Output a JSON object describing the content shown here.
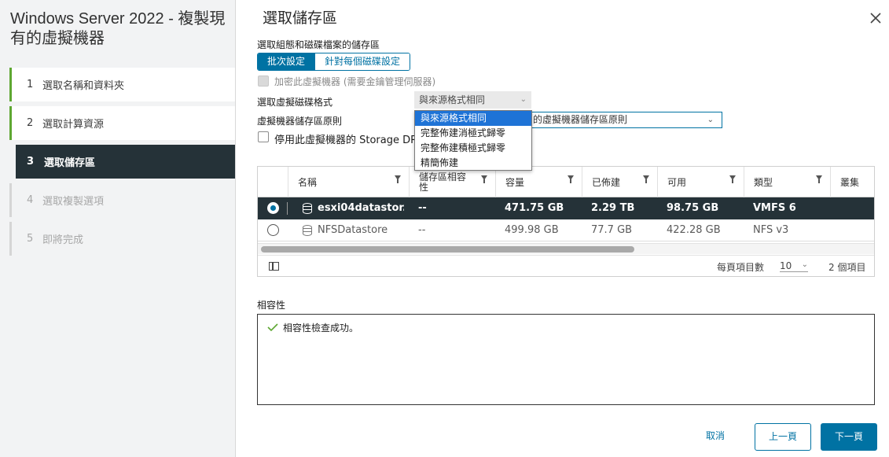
{
  "wizard": {
    "title": "Windows Server 2022 - 複製現有的虛擬機器",
    "steps": [
      {
        "num": "1",
        "label": "選取名稱和資料夾"
      },
      {
        "num": "2",
        "label": "選取計算資源"
      },
      {
        "num": "3",
        "label": "選取儲存區"
      },
      {
        "num": "4",
        "label": "選取複製選項"
      },
      {
        "num": "5",
        "label": "即將完成"
      }
    ]
  },
  "page": {
    "title": "選取儲存區",
    "close_icon": "close-icon"
  },
  "storage": {
    "config_label": "選取組態和磁碟檔案的儲存區",
    "seg_batch": "批次設定",
    "seg_per_disk": "針對每個磁碟設定",
    "encrypt_label": "加密此虛擬機器 (需要金鑰管理伺服器)",
    "disk_format_label": "選取虛擬磁碟格式",
    "disk_format_value": "與來源格式相同",
    "policy_label": "虛擬機器儲存區原則",
    "policy_value": "的虛擬機器儲存區原則",
    "drs_label": "停用此虛擬機器的 Storage DR",
    "format_options": [
      "與來源格式相同",
      "完整佈建消極式歸零",
      "完整佈建積極式歸零",
      "精簡佈建"
    ]
  },
  "grid": {
    "columns": [
      "名稱",
      "儲存區相容性",
      "容量",
      "已佈建",
      "可用",
      "類型",
      "叢集"
    ],
    "rows": [
      {
        "name": "esxi04datastor...",
        "compat": "--",
        "capacity": "471.75 GB",
        "provisioned": "2.29 TB",
        "free": "98.75 GB",
        "type": "VMFS 6",
        "selected": true
      },
      {
        "name": "NFSDatastore",
        "compat": "--",
        "capacity": "499.98 GB",
        "provisioned": "77.7 GB",
        "free": "422.28 GB",
        "type": "NFS v3",
        "selected": false
      }
    ],
    "per_page_label": "每頁項目數",
    "per_page_value": "10",
    "item_count": "2 個項目"
  },
  "compatibility": {
    "label": "相容性",
    "message": "相容性檢查成功。"
  },
  "footer": {
    "cancel": "取消",
    "back": "上一頁",
    "next": "下一頁"
  },
  "colors": {
    "accent": "#0072a3",
    "selected_row": "#253238",
    "done_step": "#5ea732",
    "success": "#5ea732"
  }
}
